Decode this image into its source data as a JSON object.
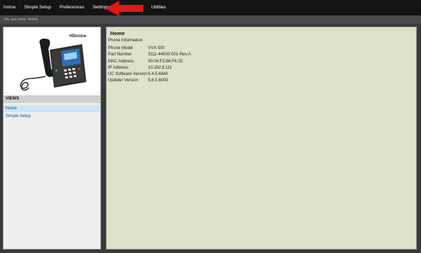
{
  "nav": {
    "items": [
      "Home",
      "Simple Setup",
      "Preferences",
      "Settings",
      "Utilities"
    ]
  },
  "breadcrumb": {
    "text": "You are here: Home"
  },
  "phone_image": {
    "brand_text": "HDvoice"
  },
  "sidebar": {
    "header": "VIEWS",
    "items": [
      {
        "label": "Home",
        "active": true
      },
      {
        "label": "Simple Setup",
        "active": false
      }
    ]
  },
  "main": {
    "title": "Home",
    "section": "Phone Information",
    "rows": [
      {
        "label": "Phone Model",
        "value": "VVX 500"
      },
      {
        "label": "Part Number",
        "value": "3111-44500-001 Rev:A"
      },
      {
        "label": "MAC Address",
        "value": "00:04:F2:66:F6:1E"
      },
      {
        "label": "IP Address",
        "value": "10.192.8.111"
      },
      {
        "label": "UC Software Version",
        "value": "5.4.5.6840"
      },
      {
        "label": "Updater Version",
        "value": "5.6.5.6003"
      }
    ]
  },
  "colors": {
    "nav_bg": "#141414",
    "page_bg": "#3a3a3a",
    "main_bg": "#dde3c8",
    "arrow": "#e01818",
    "active_view": "#cfe3f7"
  }
}
